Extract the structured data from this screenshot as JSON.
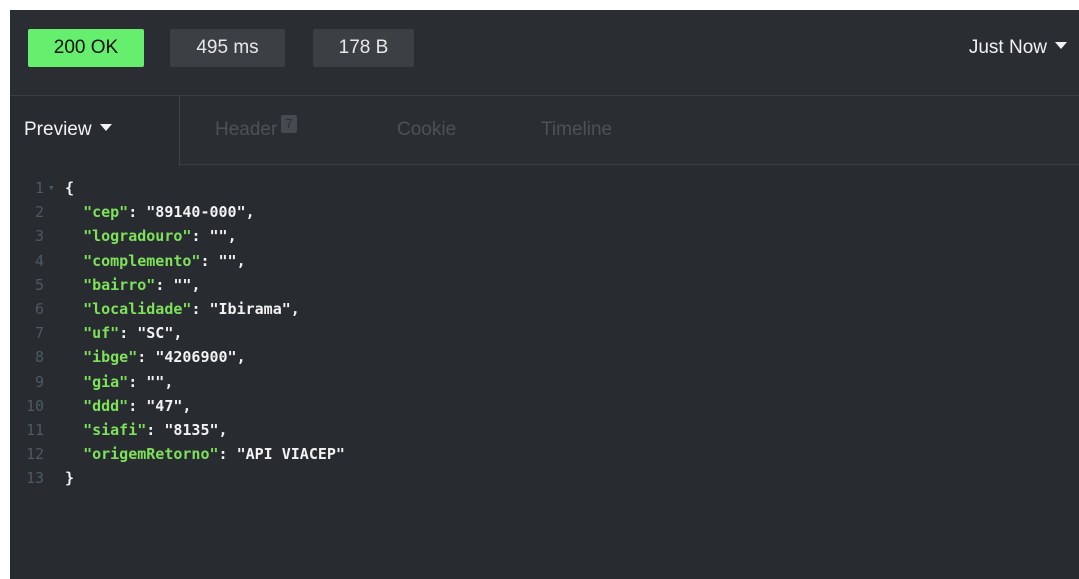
{
  "response": {
    "status": "200 OK",
    "time": "495 ms",
    "size": "178 B",
    "history_label": "Just Now"
  },
  "tabs": {
    "preview": "Preview",
    "header": "Header",
    "header_count": "7",
    "cookie": "Cookie",
    "timeline": "Timeline"
  },
  "code": {
    "open_brace": "{",
    "close_brace": "}",
    "fold_glyph": "▾",
    "line_numbers": [
      "1",
      "2",
      "3",
      "4",
      "5",
      "6",
      "7",
      "8",
      "9",
      "10",
      "11",
      "12",
      "13"
    ],
    "fields": [
      {
        "key": "\"cep\"",
        "value": "\"89140-000\"",
        "sep": ","
      },
      {
        "key": "\"logradouro\"",
        "value": "\"\"",
        "sep": ","
      },
      {
        "key": "\"complemento\"",
        "value": "\"\"",
        "sep": ","
      },
      {
        "key": "\"bairro\"",
        "value": "\"\"",
        "sep": ","
      },
      {
        "key": "\"localidade\"",
        "value": "\"Ibirama\"",
        "sep": ","
      },
      {
        "key": "\"uf\"",
        "value": "\"SC\"",
        "sep": ","
      },
      {
        "key": "\"ibge\"",
        "value": "\"4206900\"",
        "sep": ","
      },
      {
        "key": "\"gia\"",
        "value": "\"\"",
        "sep": ","
      },
      {
        "key": "\"ddd\"",
        "value": "\"47\"",
        "sep": ","
      },
      {
        "key": "\"siafi\"",
        "value": "\"8135\"",
        "sep": ","
      },
      {
        "key": "\"origemRetorno\"",
        "value": "\"API VIACEP\"",
        "sep": ""
      }
    ],
    "colon": ": "
  },
  "colors": {
    "status_ok": "#66ee6e",
    "json_key": "#7ee15a",
    "background": "#282b30"
  }
}
